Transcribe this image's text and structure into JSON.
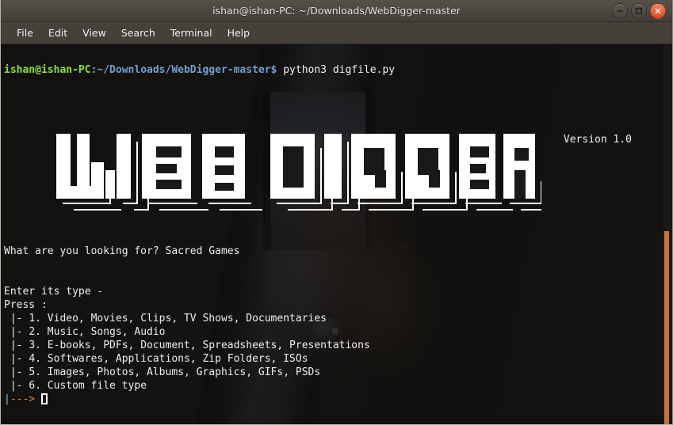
{
  "window": {
    "title": "ishan@ishan-PC: ~/Downloads/WebDigger-master",
    "controls": [
      {
        "name": "minimize",
        "glyph": "minimize-icon"
      },
      {
        "name": "maximize",
        "glyph": "maximize-icon"
      },
      {
        "name": "close",
        "glyph": "close-icon"
      }
    ]
  },
  "menubar": {
    "items": [
      "File",
      "Edit",
      "View",
      "Search",
      "Terminal",
      "Help"
    ]
  },
  "terminal": {
    "prompt": {
      "user": "ishan@ishan-PC",
      "path": ":~/Downloads/WebDigger-master$",
      "command": " python3 digfile.py"
    },
    "banner": {
      "text": "WEB DIGGER",
      "style": "block-ascii-art"
    },
    "version": "Version 1.0",
    "question_line": "What are you looking for? ",
    "question_answer": "Sacred Games",
    "blank_1": "",
    "type_prompt": "Enter its type -",
    "press_label": "Press :",
    "options": [
      {
        "prefix": "|- ",
        "number": "1.",
        "label": " Video, Movies, Clips, TV Shows, Documentaries"
      },
      {
        "prefix": "|- ",
        "number": "2.",
        "label": " Music, Songs, Audio"
      },
      {
        "prefix": "|- ",
        "number": "3.",
        "label": " E-books, PDFs, Document, Spreadsheets, Presentations"
      },
      {
        "prefix": "|- ",
        "number": "4.",
        "label": " Softwares, Applications, Zip Folders, ISOs"
      },
      {
        "prefix": "|- ",
        "number": "5.",
        "label": " Images, Photos, Albums, Graphics, GIFs, PSDs"
      },
      {
        "prefix": "|- ",
        "number": "6.",
        "label": " Custom file type"
      }
    ],
    "input_prompt_bar": "|",
    "input_prompt_arrow": "--->",
    "input_value": ""
  },
  "colors": {
    "prompt_user": "#8ae234",
    "prompt_path": "#729fcf",
    "foreground": "#f0eeec",
    "arrow": "#e08b46",
    "scrollbar_thumb": "#c8713f",
    "titlebar": "#4a443f",
    "terminal_bg": "#1b1917"
  }
}
